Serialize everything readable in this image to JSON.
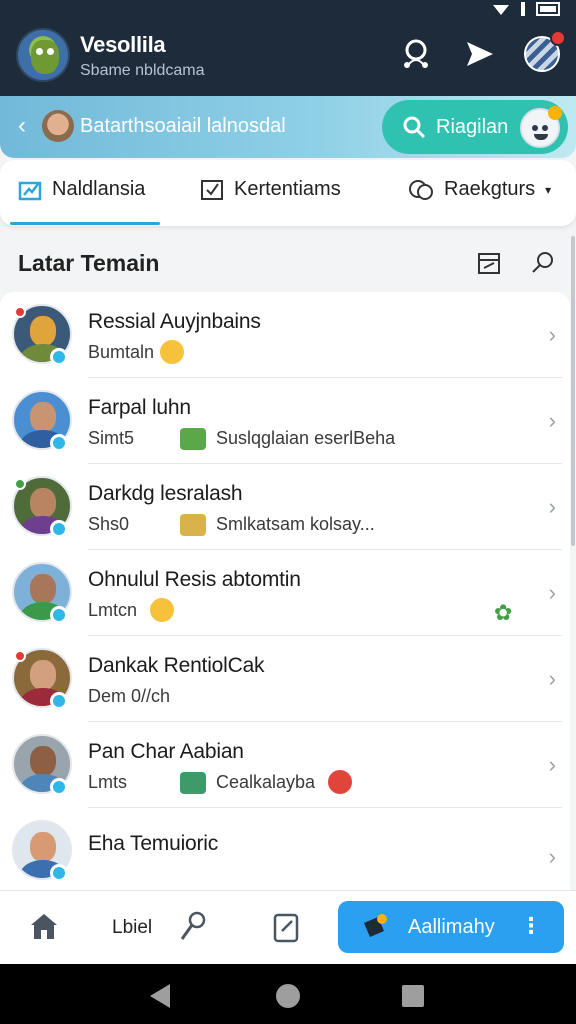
{
  "header": {
    "title": "Vesollila",
    "subtitle": "Sbame nbldcama"
  },
  "banner": {
    "back_icon": "chevron-left-icon",
    "text": "Batarthsoaiail lalnosdal",
    "search_label": "Riagilan"
  },
  "tabs": [
    {
      "label": "Naldlansia",
      "icon": "chart-icon",
      "active": true
    },
    {
      "label": "Kertentiams",
      "icon": "checkbox-icon",
      "active": false
    },
    {
      "label": "Raekgturs",
      "icon": "chat-bubble-icon",
      "active": false
    }
  ],
  "section": {
    "title": "Latar Temain"
  },
  "contacts": [
    {
      "name": "Ressial Auyjnbains",
      "meta": "Bumtaln",
      "snippet": ""
    },
    {
      "name": "Farpal luhn",
      "meta": "Simt5",
      "snippet": "Suslqglaian eserlBeha"
    },
    {
      "name": "Darkdg lesralash",
      "meta": "Shs0",
      "snippet": "Smlkatsam kolsay..."
    },
    {
      "name": "Ohnulul Resis abtomtin",
      "meta": "Lmtcn",
      "snippet": ""
    },
    {
      "name": "Dankak RentiolCak",
      "meta": "Dem 0//ch",
      "snippet": ""
    },
    {
      "name": "Pan Char Aabian",
      "meta": "Lmts",
      "snippet": "Cealkalayba"
    },
    {
      "name": "Eha Temuioric",
      "meta": "",
      "snippet": ""
    }
  ],
  "bottom_bar": {
    "label": "Lbiel",
    "action_label": "Aallimahy",
    "more": "⋮"
  },
  "colors": {
    "header_bg": "#1e2b3a",
    "accent_teal": "#30c2b0",
    "accent_blue": "#2b9ff0",
    "tab_underline": "#2aa6d8"
  }
}
